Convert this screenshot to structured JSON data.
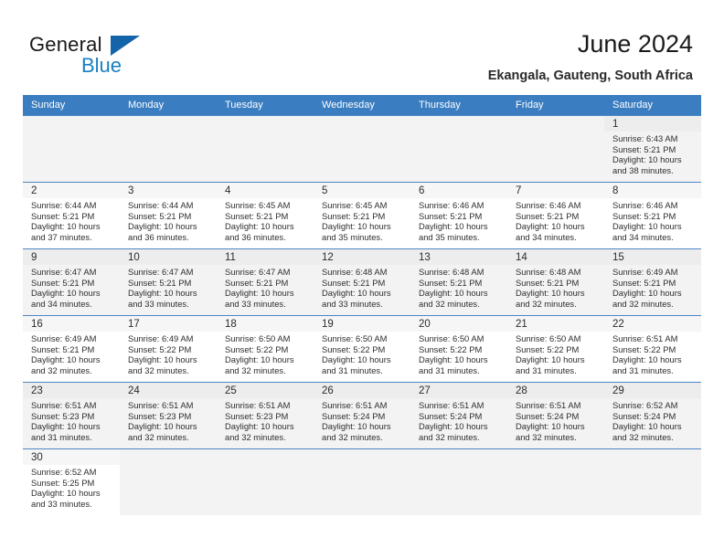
{
  "brand": {
    "line1": "General",
    "line2": "Blue",
    "triangle_color": "#1464aa",
    "blue_text_color": "#1a7fc1"
  },
  "header": {
    "title": "June 2024",
    "subtitle": "Ekangala, Gauteng, South Africa"
  },
  "theme": {
    "header_band": "#3a7dc0",
    "shaded_cell": "#f3f3f3",
    "plain_cell": "#ffffff",
    "daynum_band": "#ededed",
    "text": "#2e2e2e"
  },
  "weekdays": [
    "Sunday",
    "Monday",
    "Tuesday",
    "Wednesday",
    "Thursday",
    "Friday",
    "Saturday"
  ],
  "weeks": [
    [
      {
        "empty": true
      },
      {
        "empty": true
      },
      {
        "empty": true
      },
      {
        "empty": true
      },
      {
        "empty": true
      },
      {
        "empty": true
      },
      {
        "day": "1",
        "sunrise": "Sunrise: 6:43 AM",
        "sunset": "Sunset: 5:21 PM",
        "daylight1": "Daylight: 10 hours",
        "daylight2": "and 38 minutes."
      }
    ],
    [
      {
        "day": "2",
        "sunrise": "Sunrise: 6:44 AM",
        "sunset": "Sunset: 5:21 PM",
        "daylight1": "Daylight: 10 hours",
        "daylight2": "and 37 minutes."
      },
      {
        "day": "3",
        "sunrise": "Sunrise: 6:44 AM",
        "sunset": "Sunset: 5:21 PM",
        "daylight1": "Daylight: 10 hours",
        "daylight2": "and 36 minutes."
      },
      {
        "day": "4",
        "sunrise": "Sunrise: 6:45 AM",
        "sunset": "Sunset: 5:21 PM",
        "daylight1": "Daylight: 10 hours",
        "daylight2": "and 36 minutes."
      },
      {
        "day": "5",
        "sunrise": "Sunrise: 6:45 AM",
        "sunset": "Sunset: 5:21 PM",
        "daylight1": "Daylight: 10 hours",
        "daylight2": "and 35 minutes."
      },
      {
        "day": "6",
        "sunrise": "Sunrise: 6:46 AM",
        "sunset": "Sunset: 5:21 PM",
        "daylight1": "Daylight: 10 hours",
        "daylight2": "and 35 minutes."
      },
      {
        "day": "7",
        "sunrise": "Sunrise: 6:46 AM",
        "sunset": "Sunset: 5:21 PM",
        "daylight1": "Daylight: 10 hours",
        "daylight2": "and 34 minutes."
      },
      {
        "day": "8",
        "sunrise": "Sunrise: 6:46 AM",
        "sunset": "Sunset: 5:21 PM",
        "daylight1": "Daylight: 10 hours",
        "daylight2": "and 34 minutes."
      }
    ],
    [
      {
        "day": "9",
        "sunrise": "Sunrise: 6:47 AM",
        "sunset": "Sunset: 5:21 PM",
        "daylight1": "Daylight: 10 hours",
        "daylight2": "and 34 minutes."
      },
      {
        "day": "10",
        "sunrise": "Sunrise: 6:47 AM",
        "sunset": "Sunset: 5:21 PM",
        "daylight1": "Daylight: 10 hours",
        "daylight2": "and 33 minutes."
      },
      {
        "day": "11",
        "sunrise": "Sunrise: 6:47 AM",
        "sunset": "Sunset: 5:21 PM",
        "daylight1": "Daylight: 10 hours",
        "daylight2": "and 33 minutes."
      },
      {
        "day": "12",
        "sunrise": "Sunrise: 6:48 AM",
        "sunset": "Sunset: 5:21 PM",
        "daylight1": "Daylight: 10 hours",
        "daylight2": "and 33 minutes."
      },
      {
        "day": "13",
        "sunrise": "Sunrise: 6:48 AM",
        "sunset": "Sunset: 5:21 PM",
        "daylight1": "Daylight: 10 hours",
        "daylight2": "and 32 minutes."
      },
      {
        "day": "14",
        "sunrise": "Sunrise: 6:48 AM",
        "sunset": "Sunset: 5:21 PM",
        "daylight1": "Daylight: 10 hours",
        "daylight2": "and 32 minutes."
      },
      {
        "day": "15",
        "sunrise": "Sunrise: 6:49 AM",
        "sunset": "Sunset: 5:21 PM",
        "daylight1": "Daylight: 10 hours",
        "daylight2": "and 32 minutes."
      }
    ],
    [
      {
        "day": "16",
        "sunrise": "Sunrise: 6:49 AM",
        "sunset": "Sunset: 5:21 PM",
        "daylight1": "Daylight: 10 hours",
        "daylight2": "and 32 minutes."
      },
      {
        "day": "17",
        "sunrise": "Sunrise: 6:49 AM",
        "sunset": "Sunset: 5:22 PM",
        "daylight1": "Daylight: 10 hours",
        "daylight2": "and 32 minutes."
      },
      {
        "day": "18",
        "sunrise": "Sunrise: 6:50 AM",
        "sunset": "Sunset: 5:22 PM",
        "daylight1": "Daylight: 10 hours",
        "daylight2": "and 32 minutes."
      },
      {
        "day": "19",
        "sunrise": "Sunrise: 6:50 AM",
        "sunset": "Sunset: 5:22 PM",
        "daylight1": "Daylight: 10 hours",
        "daylight2": "and 31 minutes."
      },
      {
        "day": "20",
        "sunrise": "Sunrise: 6:50 AM",
        "sunset": "Sunset: 5:22 PM",
        "daylight1": "Daylight: 10 hours",
        "daylight2": "and 31 minutes."
      },
      {
        "day": "21",
        "sunrise": "Sunrise: 6:50 AM",
        "sunset": "Sunset: 5:22 PM",
        "daylight1": "Daylight: 10 hours",
        "daylight2": "and 31 minutes."
      },
      {
        "day": "22",
        "sunrise": "Sunrise: 6:51 AM",
        "sunset": "Sunset: 5:22 PM",
        "daylight1": "Daylight: 10 hours",
        "daylight2": "and 31 minutes."
      }
    ],
    [
      {
        "day": "23",
        "sunrise": "Sunrise: 6:51 AM",
        "sunset": "Sunset: 5:23 PM",
        "daylight1": "Daylight: 10 hours",
        "daylight2": "and 31 minutes."
      },
      {
        "day": "24",
        "sunrise": "Sunrise: 6:51 AM",
        "sunset": "Sunset: 5:23 PM",
        "daylight1": "Daylight: 10 hours",
        "daylight2": "and 32 minutes."
      },
      {
        "day": "25",
        "sunrise": "Sunrise: 6:51 AM",
        "sunset": "Sunset: 5:23 PM",
        "daylight1": "Daylight: 10 hours",
        "daylight2": "and 32 minutes."
      },
      {
        "day": "26",
        "sunrise": "Sunrise: 6:51 AM",
        "sunset": "Sunset: 5:24 PM",
        "daylight1": "Daylight: 10 hours",
        "daylight2": "and 32 minutes."
      },
      {
        "day": "27",
        "sunrise": "Sunrise: 6:51 AM",
        "sunset": "Sunset: 5:24 PM",
        "daylight1": "Daylight: 10 hours",
        "daylight2": "and 32 minutes."
      },
      {
        "day": "28",
        "sunrise": "Sunrise: 6:51 AM",
        "sunset": "Sunset: 5:24 PM",
        "daylight1": "Daylight: 10 hours",
        "daylight2": "and 32 minutes."
      },
      {
        "day": "29",
        "sunrise": "Sunrise: 6:52 AM",
        "sunset": "Sunset: 5:24 PM",
        "daylight1": "Daylight: 10 hours",
        "daylight2": "and 32 minutes."
      }
    ],
    [
      {
        "day": "30",
        "sunrise": "Sunrise: 6:52 AM",
        "sunset": "Sunset: 5:25 PM",
        "daylight1": "Daylight: 10 hours",
        "daylight2": "and 33 minutes."
      },
      {
        "empty": true
      },
      {
        "empty": true
      },
      {
        "empty": true
      },
      {
        "empty": true
      },
      {
        "empty": true
      },
      {
        "empty": true
      }
    ]
  ]
}
